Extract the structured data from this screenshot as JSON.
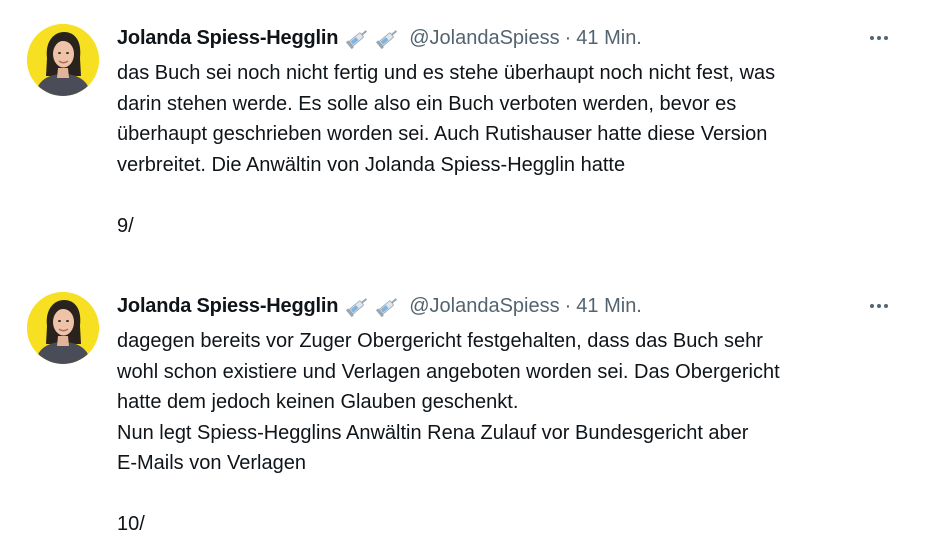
{
  "tweets": [
    {
      "author_name": "Jolanda Spiess-Hegglin",
      "badge_icons": [
        "syringe-icon",
        "syringe-icon"
      ],
      "handle": "@JolandaSpiess",
      "separator": "·",
      "time": "41 Min.",
      "more_label": "•••",
      "lines": [
        "das Buch sei noch nicht fertig und es stehe überhaupt noch nicht fest, was",
        "darin stehen werde. Es solle also ein Buch verboten werden, bevor es",
        "überhaupt geschrieben worden sei. Auch Rutishauser hatte diese Version",
        "verbreitet. Die Anwältin von Jolanda Spiess-Hegglin hatte"
      ],
      "counter": "9/"
    },
    {
      "author_name": "Jolanda Spiess-Hegglin",
      "badge_icons": [
        "syringe-icon",
        "syringe-icon"
      ],
      "handle": "@JolandaSpiess",
      "separator": "·",
      "time": "41 Min.",
      "more_label": "•••",
      "lines": [
        "dagegen bereits vor Zuger Obergericht festgehalten, dass das Buch sehr",
        "wohl schon existiere und Verlagen angeboten worden sei. Das Obergericht",
        "hatte dem jedoch keinen Glauben geschenkt.",
        "Nun legt Spiess-Hegglins Anwältin Rena Zulauf vor Bundesgericht aber",
        "E-Mails von Verlagen"
      ],
      "counter": "10/"
    }
  ],
  "colors": {
    "text": "#0f1419",
    "secondary": "#536471",
    "avatar_background": "#f7e021"
  }
}
